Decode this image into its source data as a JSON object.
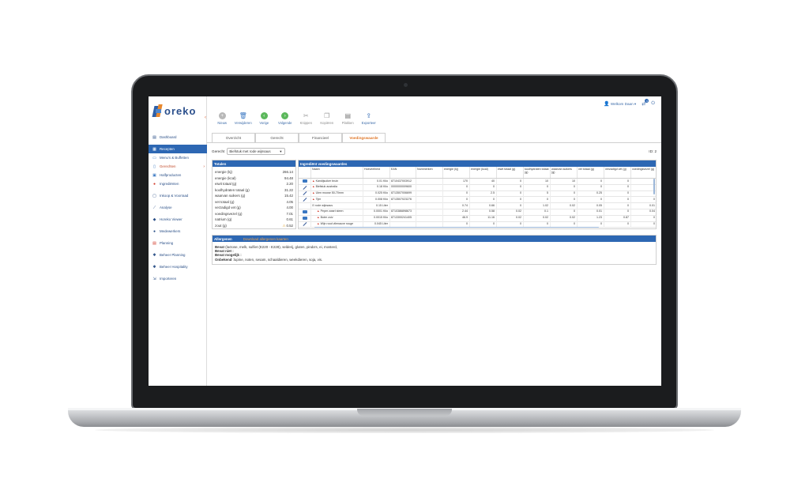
{
  "app": {
    "brand": "oreko",
    "user_greeting": "Welkom Daan",
    "notification_count": "4"
  },
  "colors": {
    "primary": "#2d67b3",
    "accent": "#e0782a",
    "active_nav": "#c24a2a"
  },
  "sidebar": {
    "items": [
      {
        "label": "Dashboard",
        "icon": "dashboard-icon"
      },
      {
        "label": "Recepten",
        "icon": "recipe-icon"
      },
      {
        "label": "Menu's & Buffetten",
        "icon": "menu-icon"
      },
      {
        "label": "Gerechten",
        "icon": "dish-icon"
      },
      {
        "label": "Halfproducten",
        "icon": "halfproduct-icon"
      },
      {
        "label": "Ingrediënten",
        "icon": "ingredient-icon"
      },
      {
        "label": "Inkoop & Voorraad",
        "icon": "purchase-icon"
      },
      {
        "label": "Analyse",
        "icon": "chart-icon"
      },
      {
        "label": "Horeko Viewer",
        "icon": "viewer-icon"
      },
      {
        "label": "Medewerkers",
        "icon": "people-icon"
      },
      {
        "label": "Planning",
        "icon": "calendar-icon"
      },
      {
        "label": "Beheer Planning",
        "icon": "gear-icon"
      },
      {
        "label": "Beheer Hospitality",
        "icon": "gear-icon"
      },
      {
        "label": "Importeren",
        "icon": "import-icon"
      }
    ]
  },
  "toolbar": {
    "buttons": [
      {
        "label": "Nieuw",
        "icon": "plus-icon"
      },
      {
        "label": "Verwijderen",
        "icon": "trash-icon"
      },
      {
        "label": "Vorige",
        "icon": "arrow-left-icon"
      },
      {
        "label": "Volgende",
        "icon": "arrow-right-icon"
      },
      {
        "label": "Knippen",
        "icon": "scissors-icon"
      },
      {
        "label": "Kopiëren",
        "icon": "copy-icon"
      },
      {
        "label": "Plakken",
        "icon": "paste-icon"
      },
      {
        "label": "Exporteer",
        "icon": "export-icon"
      }
    ]
  },
  "tabs": [
    "Overzicht",
    "Gerecht",
    "Financieel",
    "Voedingswaarde"
  ],
  "gerecht": {
    "label": "Gerecht",
    "selected": "Biefstuk met rode wijnsaus",
    "id_label": "ID: 2"
  },
  "totals": {
    "title": "Totalen",
    "rows": [
      {
        "label": "energie (kj)",
        "value": "266.14"
      },
      {
        "label": "energie (kcal)",
        "value": "94.48"
      },
      {
        "label": "eiwit totaal (g)",
        "value": "2.20"
      },
      {
        "label": "koolhydraten totaal (g)",
        "value": "31.22"
      },
      {
        "label": "waarvan suikers (g)",
        "value": "15.42"
      },
      {
        "label": "vet totaal (g)",
        "value": "4.05"
      },
      {
        "label": "verzadigd vet (g)",
        "value": "4.00"
      },
      {
        "label": "voedingsvezel (g)",
        "value": "7.01"
      },
      {
        "label": "natrium (g)",
        "value": "0.61"
      },
      {
        "label": "zout (g)",
        "value": "0.52"
      }
    ]
  },
  "ingredients": {
    "title": "Ingrediënt voedingswaardes",
    "headers": [
      "Naam",
      "Hoeveelheid",
      "EAN",
      "Nummerken",
      "energie (kj)",
      "energie (kcal)",
      "eiwit totaal (g)",
      "koolhydraten totaal (g)",
      "waarvan suikers (g)",
      "vet totaal (g)",
      "verzadigd vet (g)",
      "voedingsvezel (g)"
    ],
    "rows": [
      {
        "icon": "blue",
        "name": "Kandijsuiker bruin",
        "indent": 0,
        "qty": "0.01 Kilo",
        "ean": "8710437003912",
        "nr": "",
        "v": [
          "170",
          "40",
          "0",
          "10",
          "10",
          "0",
          "0",
          "0"
        ]
      },
      {
        "icon": "slash",
        "name": "Biefstuk australia",
        "indent": 0,
        "qty": "0.18 Kilo",
        "ean": "0000000009600",
        "nr": "",
        "v": [
          "0",
          "0",
          "0",
          "0",
          "0",
          "0",
          "0",
          "0"
        ]
      },
      {
        "icon": "slash",
        "name": "Uien moose 50-70mm",
        "indent": 0,
        "qty": "0.025 Kilo",
        "ean": "8713507006699",
        "nr": "",
        "v": [
          "0",
          "2.5",
          "0",
          "5",
          "0",
          "0.25",
          "0",
          "0"
        ]
      },
      {
        "icon": "slash",
        "name": "Tijm",
        "indent": 0,
        "qty": "0.008 Kilo",
        "ean": "8713507023276",
        "nr": "",
        "v": [
          "0",
          "0",
          "0",
          "0",
          "0",
          "0",
          "0",
          "0"
        ]
      },
      {
        "icon": "none",
        "name": "rode wijnsaus",
        "indent": 0,
        "qty": "0.15 Liter",
        "ean": "",
        "nr": "",
        "v": [
          "0.74",
          "0.66",
          "0",
          "1.02",
          "0.02",
          "0.05",
          "0",
          "0.01"
        ]
      },
      {
        "icon": "blue",
        "name": "Peper zwart steen",
        "indent": 1,
        "qty": "0.0001 Kilo",
        "ean": "8710386898673",
        "nr": "",
        "v": [
          "2.44",
          "0.58",
          "0.02",
          "0.1",
          "0",
          "0.01",
          "0",
          "0.04"
        ]
      },
      {
        "icon": "blue",
        "name": "Boter zuiv",
        "indent": 1,
        "qty": "0.0015 Kilo",
        "ean": "8713300241405",
        "nr": "",
        "v": [
          "46.9",
          "11.16",
          "0.02",
          "0.02",
          "0.02",
          "1.23",
          "0.87",
          "0"
        ]
      },
      {
        "icon": "slash",
        "name": "Wijn rood vilenauve rouge",
        "indent": 1,
        "qty": "0.045 Liter",
        "ean": "",
        "nr": "",
        "v": [
          "0",
          "0",
          "0",
          "0",
          "0",
          "0",
          "0",
          "0"
        ]
      }
    ]
  },
  "allergens": {
    "title": "Allergenen",
    "download_link": "Download allergenen kaarten",
    "contains_label": "Bevat",
    "contains": "(lactose, melk, sulfiet (E220 - E228), selderij, gluten, pinda's, ei, mosterd,",
    "not_label": "Bevat niet :",
    "maybe_label": "Bevat mogelijk :",
    "unknown_label": "Onbekend",
    "unknown": ":lupine, noten, sesam, schaaldieren, weekdieren, soja, vis."
  }
}
